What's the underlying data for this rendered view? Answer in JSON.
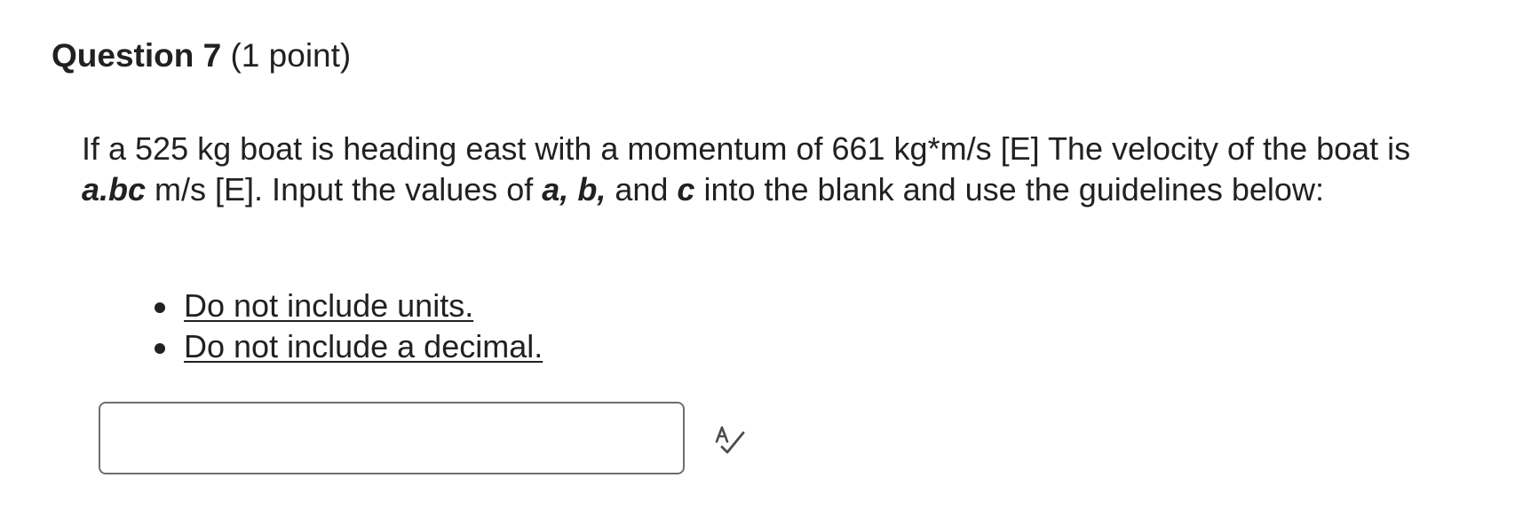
{
  "question": {
    "number_label": "Question 7",
    "points_label": "(1 point)",
    "text": {
      "part1": "If a 525 kg boat is heading east with a momentum of 661 kg*m/s [E] The velocity of the boat is ",
      "var_abc": "a.bc",
      "part2": " m/s [E]. Input the values of ",
      "var_a": "a,",
      "part3": " ",
      "var_b": "b,",
      "part4": " and ",
      "var_c": "c",
      "part5": " into the blank and use the guidelines below:"
    },
    "guidelines": [
      "Do not include units.",
      "Do not include a decimal."
    ],
    "answer": {
      "value": "",
      "placeholder": ""
    },
    "spellcheck_icon": "spellcheck-icon"
  }
}
